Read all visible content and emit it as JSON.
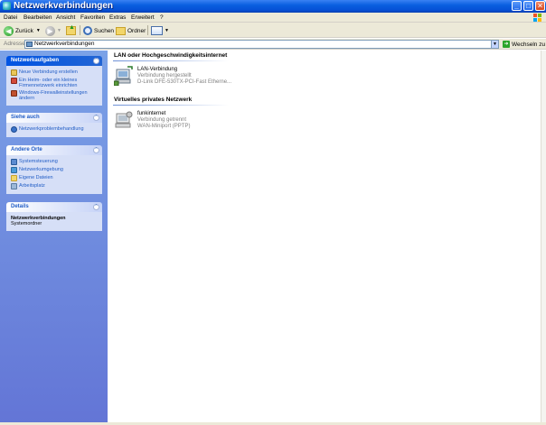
{
  "window": {
    "title": "Netzwerkverbindungen"
  },
  "menu": [
    "Datei",
    "Bearbeiten",
    "Ansicht",
    "Favoriten",
    "Extras",
    "Erweitert",
    "?"
  ],
  "toolbar": {
    "back_label": "Zurück",
    "search_label": "Suchen",
    "folders_label": "Ordner"
  },
  "address": {
    "label": "Adresse",
    "value": "Netzwerkverbindungen",
    "go_label": "Wechseln zu"
  },
  "taskpane": {
    "network_tasks": {
      "title": "Netzwerkaufgaben",
      "items": [
        "Neue Verbindung erstellen",
        "Ein Heim- oder ein kleines Firmennetzwerk einrichten",
        "Windows-Firewalleinstellungen ändern"
      ]
    },
    "see_also": {
      "title": "Siehe auch",
      "items": [
        "Netzwerkproblembehandlung"
      ]
    },
    "other_places": {
      "title": "Andere Orte",
      "items": [
        "Systemsteuerung",
        "Netzwerkumgebung",
        "Eigene Dateien",
        "Arbeitsplatz"
      ]
    },
    "details": {
      "title": "Details",
      "name": "Netzwerkverbindungen",
      "type": "Systemordner"
    }
  },
  "groups": [
    {
      "title": "LAN oder Hochgeschwindigkeitsinternet",
      "connections": [
        {
          "name": "LAN-Verbindung",
          "status": "Verbindung hergestellt",
          "device": "D-Link DFE-530TX-PCI-Fast Etherne..."
        }
      ]
    },
    {
      "title": "Virtuelles privates Netzwerk",
      "connections": [
        {
          "name": "funkinternet",
          "status": "Verbindung getrennt",
          "device": "WAN-Miniport (PPTP)"
        }
      ]
    }
  ],
  "colors": {
    "titlebar": "#0a5fe0",
    "taskpane": "#7ba2e7",
    "link": "#215dc6"
  }
}
